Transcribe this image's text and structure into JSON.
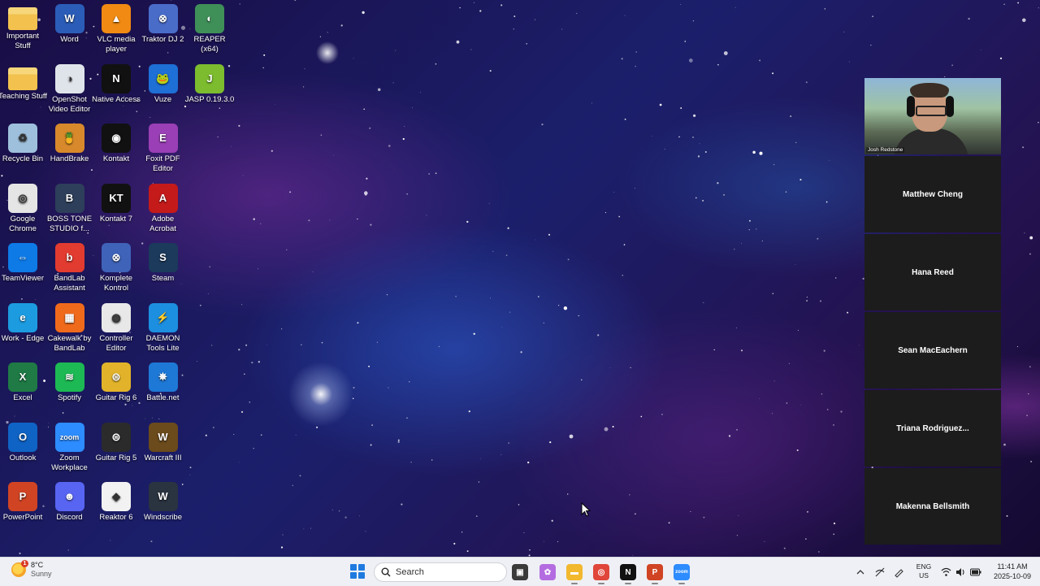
{
  "desktop": {
    "icons": [
      {
        "label": "Important Stuff",
        "icon": "folder-icon",
        "color": "#f2c14e",
        "glyph": "",
        "col": 0,
        "row": 0
      },
      {
        "label": "Word",
        "icon": "word-icon",
        "color": "#2b5db8",
        "glyph": "W",
        "col": 1,
        "row": 0
      },
      {
        "label": "VLC media player",
        "icon": "vlc-cone-icon",
        "color": "#f08a12",
        "glyph": "▲",
        "col": 2,
        "row": 0
      },
      {
        "label": "Traktor DJ 2",
        "icon": "traktor-icon",
        "color": "#4a6cc9",
        "glyph": "⊗",
        "col": 3,
        "row": 0
      },
      {
        "label": "REAPER (x64)",
        "icon": "reaper-icon",
        "color": "#3f8f58",
        "glyph": "◐",
        "col": 4,
        "row": 0
      },
      {
        "label": "Teaching Stuff",
        "icon": "folder-icon",
        "color": "#f2c14e",
        "glyph": "",
        "col": 0,
        "row": 1
      },
      {
        "label": "OpenShot Video Editor",
        "icon": "openshot-icon",
        "color": "#dfe4ea",
        "glyph": "◑",
        "col": 1,
        "row": 1
      },
      {
        "label": "Native Access",
        "icon": "native-access-icon",
        "color": "#111111",
        "glyph": "N",
        "col": 2,
        "row": 1
      },
      {
        "label": "Vuze",
        "icon": "vuze-frog-icon",
        "color": "#1e6fd6",
        "glyph": "🐸",
        "col": 3,
        "row": 1
      },
      {
        "label": "JASP 0.19.3.0",
        "icon": "jasp-icon",
        "color": "#7cbc2e",
        "glyph": "J",
        "col": 4,
        "row": 1
      },
      {
        "label": "Recycle Bin",
        "icon": "recycle-bin-icon",
        "color": "#9fc0dc",
        "glyph": "♻",
        "col": 0,
        "row": 2
      },
      {
        "label": "HandBrake",
        "icon": "handbrake-pineapple-icon",
        "color": "#d8892b",
        "glyph": "🍍",
        "col": 1,
        "row": 2
      },
      {
        "label": "Kontakt",
        "icon": "kontakt-icon",
        "color": "#111111",
        "glyph": "◉",
        "col": 2,
        "row": 2
      },
      {
        "label": "Foxit PDF Editor",
        "icon": "foxit-icon",
        "color": "#9a3fb5",
        "glyph": "E",
        "col": 3,
        "row": 2
      },
      {
        "label": "Google Chrome",
        "icon": "chrome-icon",
        "color": "#e5e5e5",
        "glyph": "◎",
        "col": 0,
        "row": 3
      },
      {
        "label": "BOSS TONE STUDIO f...",
        "icon": "boss-tone-icon",
        "color": "#2d3f5a",
        "glyph": "B",
        "col": 1,
        "row": 3
      },
      {
        "label": "Kontakt 7",
        "icon": "kontakt7-icon",
        "color": "#111111",
        "glyph": "KT",
        "col": 2,
        "row": 3
      },
      {
        "label": "Adobe Acrobat",
        "icon": "acrobat-icon",
        "color": "#c41a1a",
        "glyph": "A",
        "col": 3,
        "row": 3
      },
      {
        "label": "TeamViewer",
        "icon": "teamviewer-icon",
        "color": "#0e7ae6",
        "glyph": "⇔",
        "col": 0,
        "row": 4
      },
      {
        "label": "BandLab Assistant",
        "icon": "bandlab-icon",
        "color": "#e23b2f",
        "glyph": "b",
        "col": 1,
        "row": 4
      },
      {
        "label": "Komplete Kontrol",
        "icon": "komplete-kontrol-icon",
        "color": "#3f63b8",
        "glyph": "⊗",
        "col": 2,
        "row": 4
      },
      {
        "label": "Steam",
        "icon": "steam-icon",
        "color": "#1b3a5c",
        "glyph": "S",
        "col": 3,
        "row": 4
      },
      {
        "label": "Work - Edge",
        "icon": "edge-icon",
        "color": "#1c9be0",
        "glyph": "e",
        "col": 0,
        "row": 5
      },
      {
        "label": "Cakewalk by BandLab",
        "icon": "cakewalk-icon",
        "color": "#f06a1c",
        "glyph": "▦",
        "col": 1,
        "row": 5
      },
      {
        "label": "Controller Editor",
        "icon": "controller-editor-icon",
        "color": "#e8e8e8",
        "glyph": "◍",
        "col": 2,
        "row": 5
      },
      {
        "label": "DAEMON Tools Lite",
        "icon": "daemon-tools-icon",
        "color": "#1d8fe0",
        "glyph": "⚡",
        "col": 3,
        "row": 5
      },
      {
        "label": "Excel",
        "icon": "excel-icon",
        "color": "#1f7a45",
        "glyph": "X",
        "col": 0,
        "row": 6
      },
      {
        "label": "Spotify",
        "icon": "spotify-icon",
        "color": "#1db954",
        "glyph": "≋",
        "col": 1,
        "row": 6
      },
      {
        "label": "Guitar Rig 6",
        "icon": "guitar-rig6-icon",
        "color": "#e2b32a",
        "glyph": "⊜",
        "col": 2,
        "row": 6
      },
      {
        "label": "Battle.net",
        "icon": "battlenet-icon",
        "color": "#1e78d6",
        "glyph": "✵",
        "col": 3,
        "row": 6
      },
      {
        "label": "Outlook",
        "icon": "outlook-icon",
        "color": "#0f63c4",
        "glyph": "O",
        "col": 0,
        "row": 7
      },
      {
        "label": "Zoom Workplace",
        "icon": "zoom-icon",
        "color": "#2d8cff",
        "glyph": "zoom",
        "col": 1,
        "row": 7
      },
      {
        "label": "Guitar Rig 5",
        "icon": "guitar-rig5-icon",
        "color": "#2b2b2b",
        "glyph": "⊜",
        "col": 2,
        "row": 7
      },
      {
        "label": "Warcraft III",
        "icon": "warcraft-icon",
        "color": "#6b4a1c",
        "glyph": "W",
        "col": 3,
        "row": 7
      },
      {
        "label": "PowerPoint",
        "icon": "powerpoint-icon",
        "color": "#d04424",
        "glyph": "P",
        "col": 0,
        "row": 8
      },
      {
        "label": "Discord",
        "icon": "discord-icon",
        "color": "#5865f2",
        "glyph": "☻",
        "col": 1,
        "row": 8
      },
      {
        "label": "Reaktor 6",
        "icon": "reaktor-icon",
        "color": "#f2f2f2",
        "glyph": "◆",
        "col": 2,
        "row": 8
      },
      {
        "label": "Windscribe",
        "icon": "windscribe-icon",
        "color": "#2a3340",
        "glyph": "W",
        "col": 3,
        "row": 8
      }
    ]
  },
  "meeting": {
    "video": {
      "name": "Josh Redstone"
    },
    "participants": [
      "Matthew Cheng",
      "Hana Reed",
      "Sean MacEachern",
      "Triana  Rodriguez...",
      "Makenna Bellsmith"
    ]
  },
  "taskbar": {
    "weather": {
      "temp": "8°C",
      "condition": "Sunny",
      "badge": "1"
    },
    "search_placeholder": "Search",
    "apps": [
      {
        "name": "taskview",
        "icon": "task-view-icon",
        "color": "#3a3a3a",
        "glyph": "▣"
      },
      {
        "name": "copilot",
        "icon": "copilot-icon",
        "color": "#b46de0",
        "glyph": "✿"
      },
      {
        "name": "explorer",
        "icon": "file-explorer-icon",
        "color": "#f2b82e",
        "glyph": "▬"
      },
      {
        "name": "chrome",
        "icon": "chrome-icon",
        "color": "#e0463a",
        "glyph": "◎"
      },
      {
        "name": "native",
        "icon": "native-access-icon",
        "color": "#111111",
        "glyph": "N"
      },
      {
        "name": "powerpoint",
        "icon": "powerpoint-icon",
        "color": "#d04424",
        "glyph": "P"
      },
      {
        "name": "zoom",
        "icon": "zoom-icon",
        "color": "#2d8cff",
        "glyph": "zoom"
      }
    ],
    "lang": "ENG",
    "region": "US",
    "time": "11:41 AM",
    "date": "2025-10-09"
  }
}
